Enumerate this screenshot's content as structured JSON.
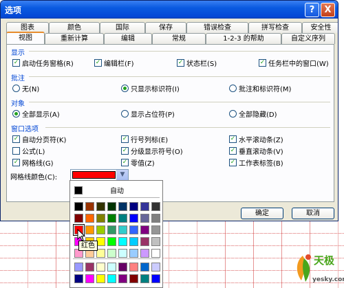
{
  "window": {
    "title": "选项",
    "help": "?",
    "close": "X"
  },
  "tabs_row1": [
    "图表",
    "颜色",
    "国际",
    "保存",
    "错误检查",
    "拼写检查",
    "安全性"
  ],
  "tabs_row2": [
    "视图",
    "重新计算",
    "编辑",
    "常规",
    "1-2-3 的帮助",
    "自定义序列"
  ],
  "active_tab": "视图",
  "sections": {
    "show": {
      "title": "显示",
      "options": [
        {
          "label": "启动任务窗格(R)",
          "checked": true
        },
        {
          "label": "编辑栏(F)",
          "checked": true
        },
        {
          "label": "状态栏(S)",
          "checked": true
        },
        {
          "label": "任务栏中的窗口(W)",
          "checked": true
        }
      ]
    },
    "comments": {
      "title": "批注",
      "options": [
        {
          "label": "无(N)",
          "selected": false
        },
        {
          "label": "只显示标识符(I)",
          "selected": true
        },
        {
          "label": "批注和标识符(M)",
          "selected": false
        }
      ]
    },
    "objects": {
      "title": "对象",
      "options": [
        {
          "label": "全部显示(A)",
          "selected": true
        },
        {
          "label": "显示占位符(P)",
          "selected": false
        },
        {
          "label": "全部隐藏(D)",
          "selected": false
        }
      ]
    },
    "window_options": {
      "title": "窗口选项",
      "options": [
        {
          "label": "自动分页符(K)",
          "checked": true
        },
        {
          "label": "行号列标(E)",
          "checked": true
        },
        {
          "label": "水平滚动条(Z)",
          "checked": true
        },
        {
          "label": "公式(L)",
          "checked": false
        },
        {
          "label": "分级显示符号(O)",
          "checked": true
        },
        {
          "label": "垂直滚动条(V)",
          "checked": true
        },
        {
          "label": "网格线(G)",
          "checked": true
        },
        {
          "label": "零值(Z)",
          "checked": true
        },
        {
          "label": "工作表标签(B)",
          "checked": true
        }
      ]
    }
  },
  "gridline_color": {
    "label": "网格线颜色(C):",
    "value": "#ff0000"
  },
  "buttons": {
    "ok": "确定",
    "cancel": "取消"
  },
  "palette": {
    "automatic_label": "自动",
    "tooltip": "红色",
    "selected_color": "#ff0000",
    "main_colors": [
      "#000000",
      "#993300",
      "#333300",
      "#003300",
      "#003366",
      "#000080",
      "#333399",
      "#333333",
      "#800000",
      "#ff6600",
      "#808000",
      "#008000",
      "#008080",
      "#0000ff",
      "#666699",
      "#808080",
      "#ff0000",
      "#ff9900",
      "#99cc00",
      "#339966",
      "#33cccc",
      "#3366ff",
      "#800080",
      "#969696",
      "#ff00ff",
      "#ffcc00",
      "#ffff00",
      "#00ff00",
      "#00ffff",
      "#00ccff",
      "#993366",
      "#c0c0c0",
      "#ff99cc",
      "#ffcc99",
      "#ffff99",
      "#ccffcc",
      "#ccffff",
      "#99ccff",
      "#cc99ff",
      "#ffffff"
    ],
    "extra_colors": [
      "#9999ff",
      "#993366",
      "#ffffcc",
      "#ccffff",
      "#660066",
      "#ff8080",
      "#0066cc",
      "#ccccff",
      "#000080",
      "#ff00ff",
      "#ffff00",
      "#00ffff",
      "#800080",
      "#800000",
      "#008080",
      "#0000ff"
    ]
  },
  "watermark": {
    "brand": "天极",
    "url": "yesky.com"
  }
}
